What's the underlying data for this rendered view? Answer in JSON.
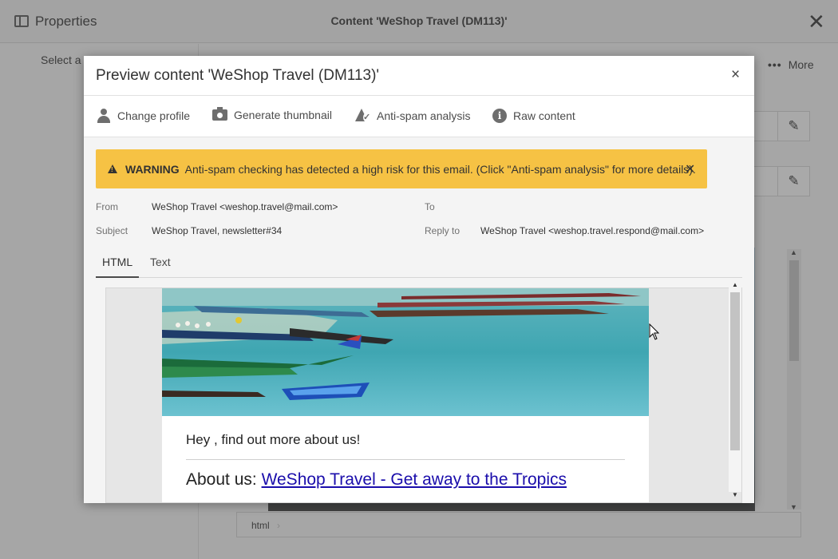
{
  "background": {
    "panel_label": "Properties",
    "window_title": "Content 'WeShop Travel (DM113)'",
    "close_glyph": "✕",
    "left_hint": "Select a",
    "more_label": "More",
    "more_icon": "more-dots-icon",
    "edit_icon": "pencil-icon",
    "breadcrumb": "html",
    "breadcrumb_chevron": "›"
  },
  "modal": {
    "title": "Preview content 'WeShop Travel (DM113)'",
    "close_glyph": "×",
    "toolbar": {
      "change_profile": "Change profile",
      "generate_thumbnail": "Generate thumbnail",
      "anti_spam": "Anti-spam analysis",
      "raw_content": "Raw content"
    },
    "warning": {
      "label": "WARNING",
      "message": "Anti-spam checking has detected a high risk for this email. (Click \"Anti-spam analysis\" for more details).",
      "close_glyph": "✕",
      "color": "#f6c244"
    },
    "headers": {
      "from_label": "From",
      "from_value": "WeShop Travel <weshop.travel@mail.com>",
      "to_label": "To",
      "to_value": "",
      "subject_label": "Subject",
      "subject_value": "WeShop Travel, newsletter#34",
      "reply_label": "Reply to",
      "reply_value": "WeShop Travel <weshop.travel.respond@mail.com>"
    },
    "tabs": [
      {
        "label": "HTML",
        "active": true
      },
      {
        "label": "Text",
        "active": false
      }
    ],
    "email_body": {
      "greeting": "Hey , find out more about us!",
      "about_prefix": "About us: ",
      "about_link": "WeShop Travel - Get away to the Tropics"
    },
    "scroll_arrow_up": "▲",
    "scroll_arrow_down": "▼"
  }
}
